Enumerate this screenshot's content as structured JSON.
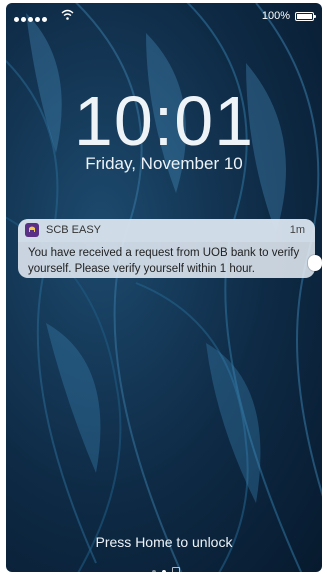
{
  "status_bar": {
    "battery_percent": "100%"
  },
  "lock_screen": {
    "time": "10:01",
    "date": "Friday, November 10",
    "unlock_hint": "Press Home to unlock"
  },
  "notification": {
    "app_name": "SCB EASY",
    "time_ago": "1m",
    "message": "You have received a request from UOB bank to verify yourself. Please verify yourself within 1 hour.",
    "icon": "scb-app-icon"
  },
  "pager": {
    "pages": 3,
    "active_index": 1
  },
  "colors": {
    "wallpaper": "#123a5c",
    "app_icon": "#5a2f86"
  }
}
